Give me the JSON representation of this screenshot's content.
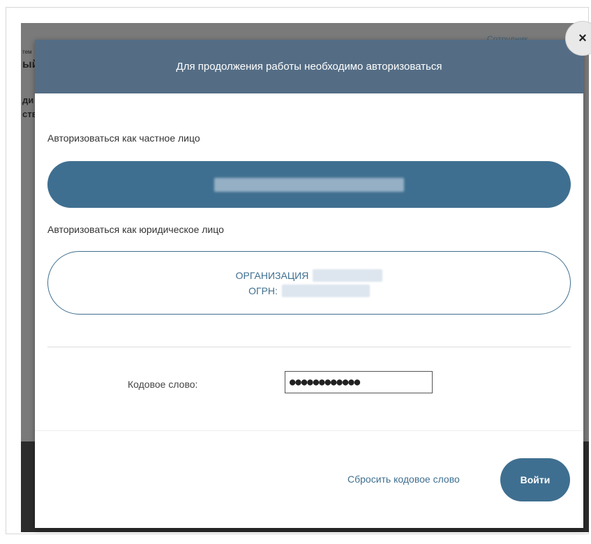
{
  "background": {
    "fragments": [
      "ый",
      "ди",
      "ств",
      "тем"
    ],
    "top_link": "Сотрудник"
  },
  "modal": {
    "title": "Для продолжения работы необходимо авторизоваться",
    "close_icon": "×",
    "private_label": "Авторизоваться как частное лицо",
    "legal_label": "Авторизоваться как юридическое лицо",
    "org_name_prefix": "ОРГАНИЗАЦИЯ",
    "org_ogrn_prefix": "ОГРН:",
    "code_label": "Кодовое слово:",
    "code_value": "●●●●●●●●●●●●",
    "reset_link": "Сбросить кодовое слово",
    "login_button": "Войти"
  },
  "colors": {
    "header": "#546d85",
    "accent": "#3f6f90"
  }
}
